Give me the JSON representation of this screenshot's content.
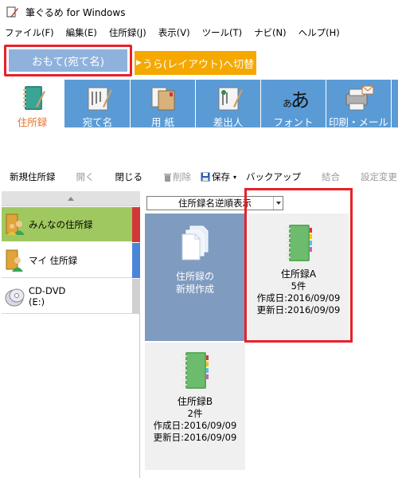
{
  "window": {
    "title": "筆ぐるめ for Windows"
  },
  "menu": {
    "items": [
      "ファイル(F)",
      "編集(E)",
      "住所録(J)",
      "表示(V)",
      "ツール(T)",
      "ナビ(N)",
      "ヘルプ(H)"
    ]
  },
  "mode_tabs": {
    "front": "おもて(宛て名)",
    "back": "うら(レイアウト)へ切替"
  },
  "ribbon": {
    "items": [
      {
        "label": "住所録",
        "icon": "address-book-icon",
        "active": true
      },
      {
        "label": "宛て名",
        "icon": "address-card-icon",
        "active": false
      },
      {
        "label": "用 紙",
        "icon": "paper-icon",
        "active": false
      },
      {
        "label": "差出人",
        "icon": "sender-icon",
        "active": false
      },
      {
        "label": "フォント",
        "icon": "font-icon",
        "active": false
      },
      {
        "label": "印刷・メール",
        "icon": "print-mail-icon",
        "active": false
      }
    ]
  },
  "toolbar": {
    "new_book": "新規住所録",
    "open": "開く",
    "close": "閉じる",
    "delete": "削除",
    "save": "保存",
    "backup": "バックアップ",
    "merge": "結合",
    "settings": "設定変更"
  },
  "left_panel": {
    "items": [
      {
        "label": "みんなの住所録",
        "selected": true,
        "stripe": "#d23838"
      },
      {
        "label": "マイ 住所録",
        "selected": false,
        "stripe": "#4a86d8"
      },
      {
        "label": "CD-DVD\n(E:)",
        "line1": "CD-DVD",
        "line2": "(E:)",
        "selected": false
      }
    ]
  },
  "sort": {
    "selected": "住所録名逆順表示"
  },
  "cards": {
    "new": {
      "line1": "住所録の",
      "line2": "新規作成"
    },
    "books": [
      {
        "name": "住所録A",
        "count": "5件",
        "created": "作成日:2016/09/09",
        "updated": "更新日:2016/09/09"
      },
      {
        "name": "住所録B",
        "count": "2件",
        "created": "作成日:2016/09/09",
        "updated": "更新日:2016/09/09"
      }
    ]
  },
  "colors": {
    "ribbon": "#5b9bd5",
    "accent_orange": "#f5a800",
    "highlight_red": "#e8202a",
    "selected_green": "#a0c860",
    "book_green": "#5aaa5a"
  }
}
